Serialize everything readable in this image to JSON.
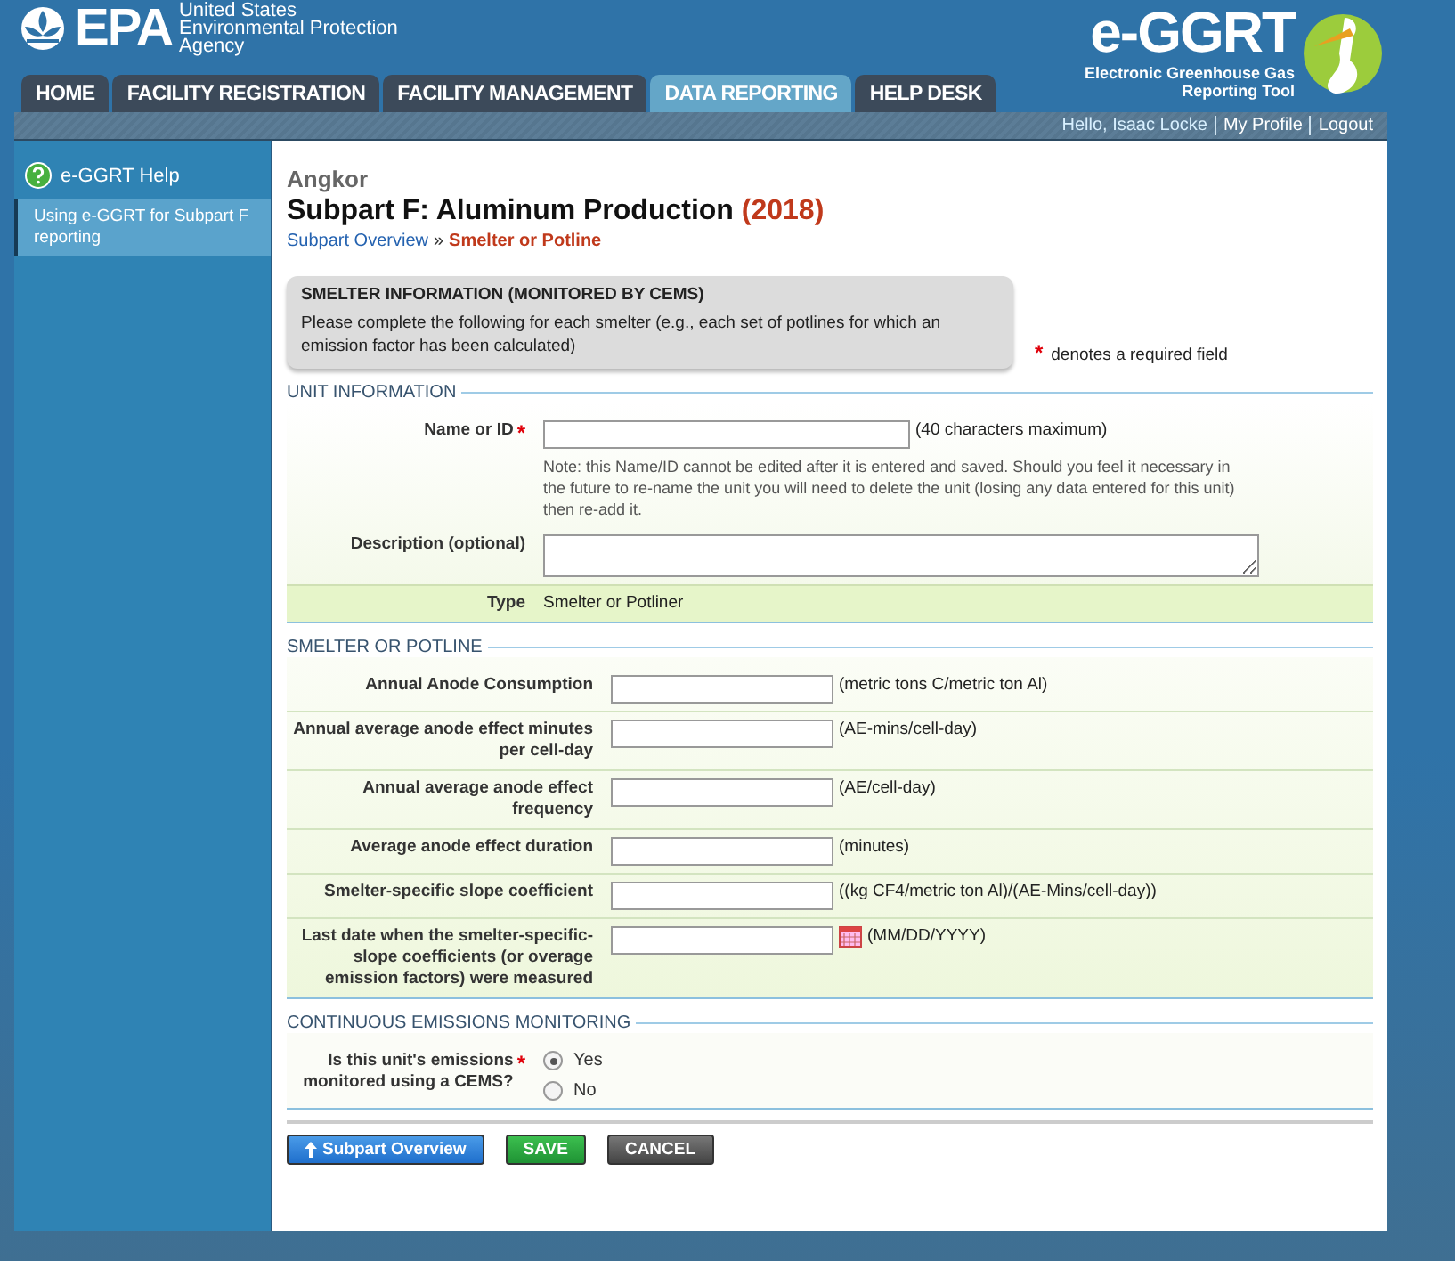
{
  "header": {
    "logo": "EPA",
    "agency": [
      "United States",
      "Environmental Protection",
      "Agency"
    ],
    "tool_name": "e-GGRT",
    "tool_subtitle": [
      "Electronic Greenhouse Gas",
      "Reporting Tool"
    ]
  },
  "tabs": [
    {
      "label": "HOME",
      "selected": false
    },
    {
      "label": "FACILITY REGISTRATION",
      "selected": false
    },
    {
      "label": "FACILITY MANAGEMENT",
      "selected": false
    },
    {
      "label": "DATA REPORTING",
      "selected": true
    },
    {
      "label": "HELP DESK",
      "selected": false
    }
  ],
  "user_bar": {
    "greeting": "Hello, Isaac Locke",
    "links": [
      "My Profile",
      "Logout"
    ]
  },
  "sidebar": {
    "help": "e-GGRT Help",
    "items": [
      {
        "label": "Using e-GGRT for Subpart F reporting",
        "selected": true
      }
    ]
  },
  "facility": "Angkor",
  "title": "Subpart F: Aluminum Production",
  "year": "(2018)",
  "breadcrumb": {
    "separator": "»",
    "items": [
      {
        "label": "Subpart Overview",
        "kind": "link"
      },
      {
        "label": "Smelter or Potline",
        "kind": "current"
      }
    ]
  },
  "info_box": {
    "title": "SMELTER INFORMATION (MONITORED BY CEMS)",
    "text": "Please complete the following for each smelter (e.g., each set of potlines for which an emission factor has been calculated)"
  },
  "required_note": {
    "mark": "*",
    "text": "denotes a required field"
  },
  "sections": [
    {
      "title": "UNIT INFORMATION",
      "rows": [
        {
          "kind": "text",
          "label": "Name or ID",
          "required": true,
          "hint": "(40 characters maximum)",
          "note": "Note: this Name/ID cannot be edited after it is entered and saved. Should you feel it necessary in the future to re-name the unit you will need to delete the unit (losing any data entered for this unit) then re-add it."
        },
        {
          "kind": "textarea",
          "label": "Description (optional)",
          "required": false
        },
        {
          "kind": "static",
          "label": "Type",
          "required": false,
          "value": "Smelter or Potliner"
        }
      ]
    },
    {
      "title": "SMELTER OR POTLINE",
      "rows": [
        {
          "kind": "text",
          "label": "Annual Anode Consumption",
          "required": false,
          "hint": "(metric tons C/metric ton Al)"
        },
        {
          "kind": "text",
          "label": "Annual average anode effect minutes per cell-day",
          "required": false,
          "hint": "(AE-mins/cell-day)"
        },
        {
          "kind": "text",
          "label": "Annual average anode effect frequency",
          "required": false,
          "hint": "(AE/cell-day)"
        },
        {
          "kind": "text",
          "label": "Average anode effect duration",
          "required": false,
          "hint": "(minutes)"
        },
        {
          "kind": "text",
          "label": "Smelter-specific slope coefficient",
          "required": false,
          "hint": "((kg CF4/metric ton Al)/(AE-Mins/cell-day))"
        },
        {
          "kind": "date",
          "label": "Last date when the smelter-specific-slope coefficients (or overage emission factors) were measured",
          "required": false,
          "hint": "(MM/DD/YYYY)"
        }
      ]
    },
    {
      "title": "CONTINUOUS EMISSIONS MONITORING",
      "rows": [
        {
          "kind": "radio",
          "label": "Is this unit's emissions monitored using a CEMS?",
          "required": true,
          "options": [
            {
              "label": "Yes",
              "selected": true
            },
            {
              "label": "No",
              "selected": false
            }
          ]
        }
      ]
    }
  ],
  "buttons": [
    {
      "label": "Subpart Overview",
      "kind": "back"
    },
    {
      "label": "SAVE",
      "kind": "save"
    },
    {
      "label": "CANCEL",
      "kind": "cancel"
    }
  ]
}
